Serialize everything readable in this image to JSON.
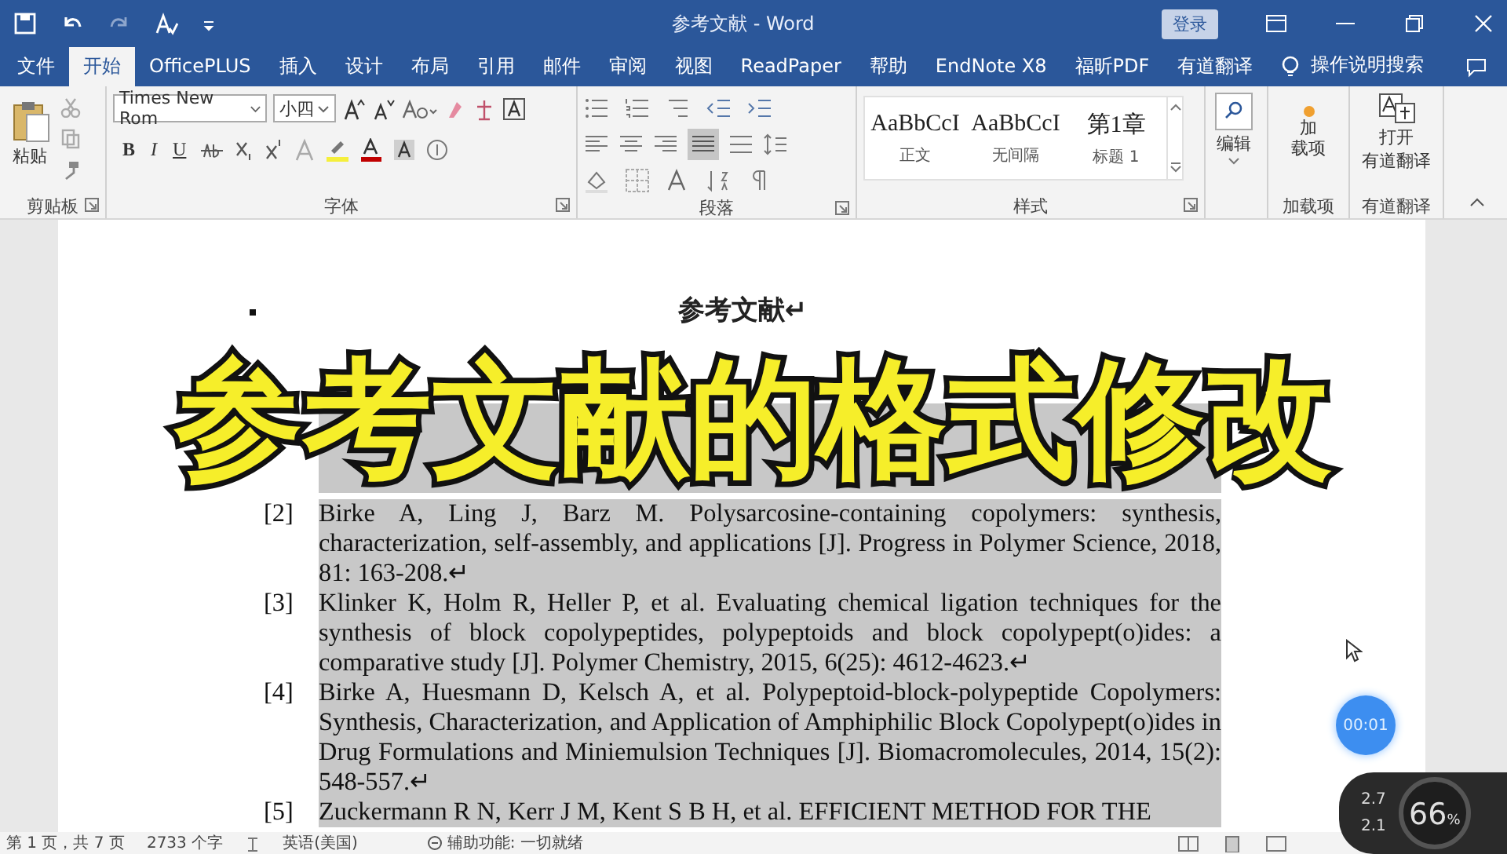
{
  "window": {
    "title": "参考文献  -  Word",
    "login_button": "登录"
  },
  "menu_tabs": [
    {
      "label": "文件",
      "selected": false
    },
    {
      "label": "开始",
      "selected": true
    },
    {
      "label": "OfficePLUS",
      "selected": false
    },
    {
      "label": "插入",
      "selected": false
    },
    {
      "label": "设计",
      "selected": false
    },
    {
      "label": "布局",
      "selected": false
    },
    {
      "label": "引用",
      "selected": false
    },
    {
      "label": "邮件",
      "selected": false
    },
    {
      "label": "审阅",
      "selected": false
    },
    {
      "label": "视图",
      "selected": false
    },
    {
      "label": "ReadPaper",
      "selected": false
    },
    {
      "label": "帮助",
      "selected": false
    },
    {
      "label": "EndNote X8",
      "selected": false
    },
    {
      "label": "福昕PDF",
      "selected": false
    },
    {
      "label": "有道翻译",
      "selected": false
    }
  ],
  "tell_me": "操作说明搜索",
  "ribbon": {
    "paste_label": "粘贴",
    "clipboard_label": "剪贴板",
    "font_name": "Times New Rom",
    "font_size": "小四",
    "font_label": "字体",
    "format_buttons": [
      "B",
      "I",
      "U"
    ],
    "paragraph_label": "段落",
    "styles": [
      {
        "preview": "AaBbCcI",
        "name": "正文"
      },
      {
        "preview": "AaBbCcI",
        "name": "无间隔"
      },
      {
        "preview": "第1章",
        "name": "标题 1"
      }
    ],
    "styles_label": "样式",
    "edit_label": "编辑",
    "addin_button": [
      "加",
      "载项"
    ],
    "addin_label": "加载项",
    "translate_button": [
      "打开",
      "有道翻译"
    ],
    "translate_label": "有道翻译"
  },
  "document": {
    "heading": "参考文献↵",
    "references": [
      {
        "number": "[2]",
        "text": "Birke A, Ling J, Barz M. Polysarcosine-containing copolymers: synthesis, characterization, self-assembly, and applications [J]. Progress in Polymer Science, 2018, 81: 163-208.↵",
        "selected": true
      },
      {
        "number": "[3]",
        "text": "Klinker K, Holm R, Heller P, et al. Evaluating chemical ligation techniques for the synthesis of block copolypeptides, polypeptoids and block copolypept(o)ides: a comparative study [J]. Polymer Chemistry, 2015, 6(25): 4612-4623.↵",
        "selected": true
      },
      {
        "number": "[4]",
        "text": "Birke A, Huesmann D, Kelsch A, et al. Polypeptoid-block-polypeptide Copolymers: Synthesis, Characterization, and Application of Amphiphilic Block Copolypept(o)ides in Drug Formulations and Miniemulsion Techniques [J]. Biomacromolecules, 2014, 15(2): 548-557.↵",
        "selected": true
      },
      {
        "number": "[5]",
        "text": "Zuckermann R N, Kerr J M, Kent S B H, et al. EFFICIENT METHOD FOR THE",
        "selected": true
      }
    ]
  },
  "status_bar": {
    "page": "第 1 页，共 7 页",
    "words": "2733 个字",
    "language": "英语(美国)",
    "accessibility": "辅助功能: 一切就绪"
  },
  "caption": "参考文献的格式修改",
  "timer": "00:01",
  "speed_widget": {
    "upload": "2.7",
    "download": "2.1",
    "percent": "66",
    "unit": "%"
  }
}
